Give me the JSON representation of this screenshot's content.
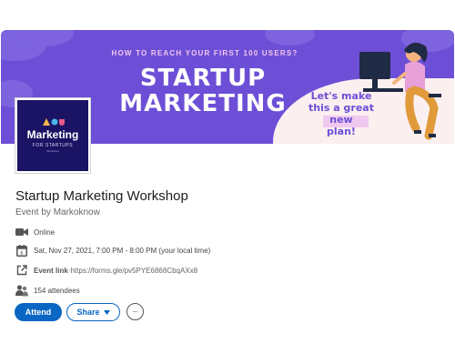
{
  "banner": {
    "kicker": "HOW TO REACH YOUR FIRST 100 USERS?",
    "title_line1": "STARTUP",
    "title_line2": "MARKETING",
    "speech_line1": "Let's make",
    "speech_line2": "this a great new",
    "speech_line3": "plan!",
    "colors": {
      "background": "#6c4fd6",
      "accent": "#fbeff0"
    }
  },
  "logo": {
    "title": "Marketing",
    "subtitle": "FOR STARTUPS",
    "tiny": "Workshop"
  },
  "event": {
    "title": "Startup Marketing Workshop",
    "organizer": "Event by Markoknow",
    "format": "Online",
    "datetime": "Sat, Nov 27, 2021, 7:00 PM - 8:00 PM (your local time)",
    "link_label": "Event link",
    "link_separator": " · ",
    "link_url": "https://forms.gle/pv5PYE6868CbqAXx8",
    "attendees": "154 attendees"
  },
  "actions": {
    "attend_label": "Attend",
    "share_label": "Share",
    "more_icon": "ellipsis-icon"
  },
  "icons": [
    "video-camera-icon",
    "calendar-icon",
    "external-link-icon",
    "people-icon",
    "caret-down-icon"
  ],
  "colors": {
    "primary": "#0a66c2"
  }
}
